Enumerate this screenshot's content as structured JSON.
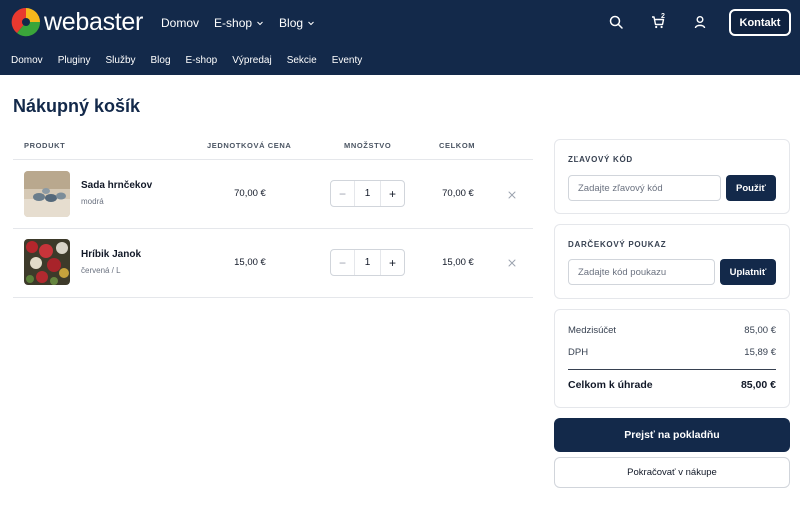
{
  "brand": {
    "logo_text": "webaster",
    "colors": {
      "primary": "#13294a",
      "logo_red": "#e8392f",
      "logo_yellow": "#f6b81c",
      "logo_green": "#3aa53a"
    }
  },
  "header": {
    "main_nav": [
      {
        "label": "Domov",
        "has_dropdown": false
      },
      {
        "label": "E-shop",
        "has_dropdown": true
      },
      {
        "label": "Blog",
        "has_dropdown": true
      }
    ],
    "icons": [
      "search-icon",
      "cart-icon",
      "user-icon"
    ],
    "cart_count": "2",
    "contact_button": "Kontakt",
    "sub_nav": [
      "Domov",
      "Pluginy",
      "Služby",
      "Blog",
      "E-shop",
      "Výpredaj",
      "Sekcie",
      "Eventy"
    ]
  },
  "page": {
    "title": "Nákupný košík"
  },
  "cart": {
    "columns": [
      "PRODUKT",
      "JEDNOTKOVÁ CENA",
      "MNOŽSTVO",
      "CELKOM"
    ],
    "items": [
      {
        "name": "Sada hrnčekov",
        "variant": "modrá",
        "unit_price": "70,00 €",
        "quantity": "1",
        "total": "70,00 €",
        "image": "mugs-photo"
      },
      {
        "name": "Hríbik Janok",
        "variant": "červená / L",
        "unit_price": "15,00 €",
        "quantity": "1",
        "total": "15,00 €",
        "image": "flowers-photo"
      }
    ]
  },
  "sidebar": {
    "discount": {
      "label": "ZĽAVOVÝ KÓD",
      "placeholder": "Zadajte zľavový kód",
      "button": "Použiť"
    },
    "voucher": {
      "label": "DARČEKOVÝ POUKAZ",
      "placeholder": "Zadajte kód poukazu",
      "button": "Uplatniť"
    },
    "summary": {
      "subtotal_label": "Medzisúčet",
      "subtotal": "85,00 €",
      "vat_label": "DPH",
      "vat": "15,89 €",
      "total_label": "Celkom k úhrade",
      "total": "85,00 €"
    },
    "checkout_button": "Prejsť na pokladňu",
    "continue_button": "Pokračovať v nákupe"
  }
}
